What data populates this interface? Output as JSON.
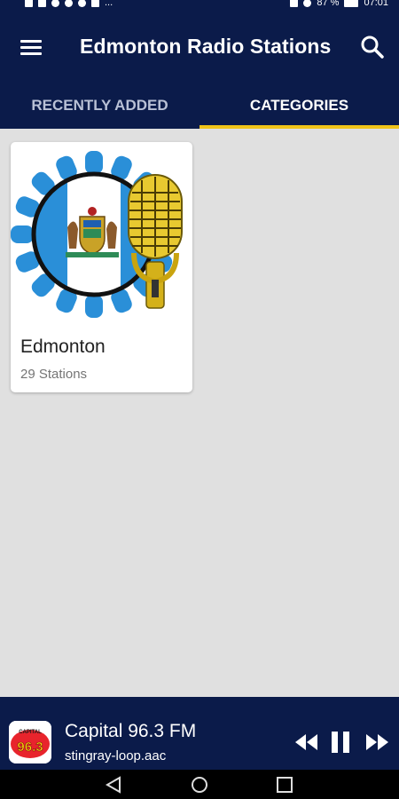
{
  "status_bar": {
    "battery_percent": "87 %",
    "time": "07:01",
    "overflow": "..."
  },
  "app_bar": {
    "title": "Edmonton Radio Stations",
    "menu_icon": "hamburger-menu-icon",
    "search_icon": "search-icon"
  },
  "tabs": [
    {
      "label": "RECENTLY ADDED",
      "active": false
    },
    {
      "label": "CATEGORIES",
      "active": true
    }
  ],
  "categories": [
    {
      "name": "Edmonton",
      "count_label": "29 Stations",
      "image": "edmonton-flag-microphone-image"
    }
  ],
  "player": {
    "station_name": "Capital 96.3 FM",
    "stream": "stingray-loop.aac",
    "logo_text": "96.3",
    "logo_label": "CAPITAL",
    "state": "playing"
  },
  "colors": {
    "primary": "#0b1b4a",
    "accent": "#f0c419",
    "background": "#e0e0e0"
  }
}
